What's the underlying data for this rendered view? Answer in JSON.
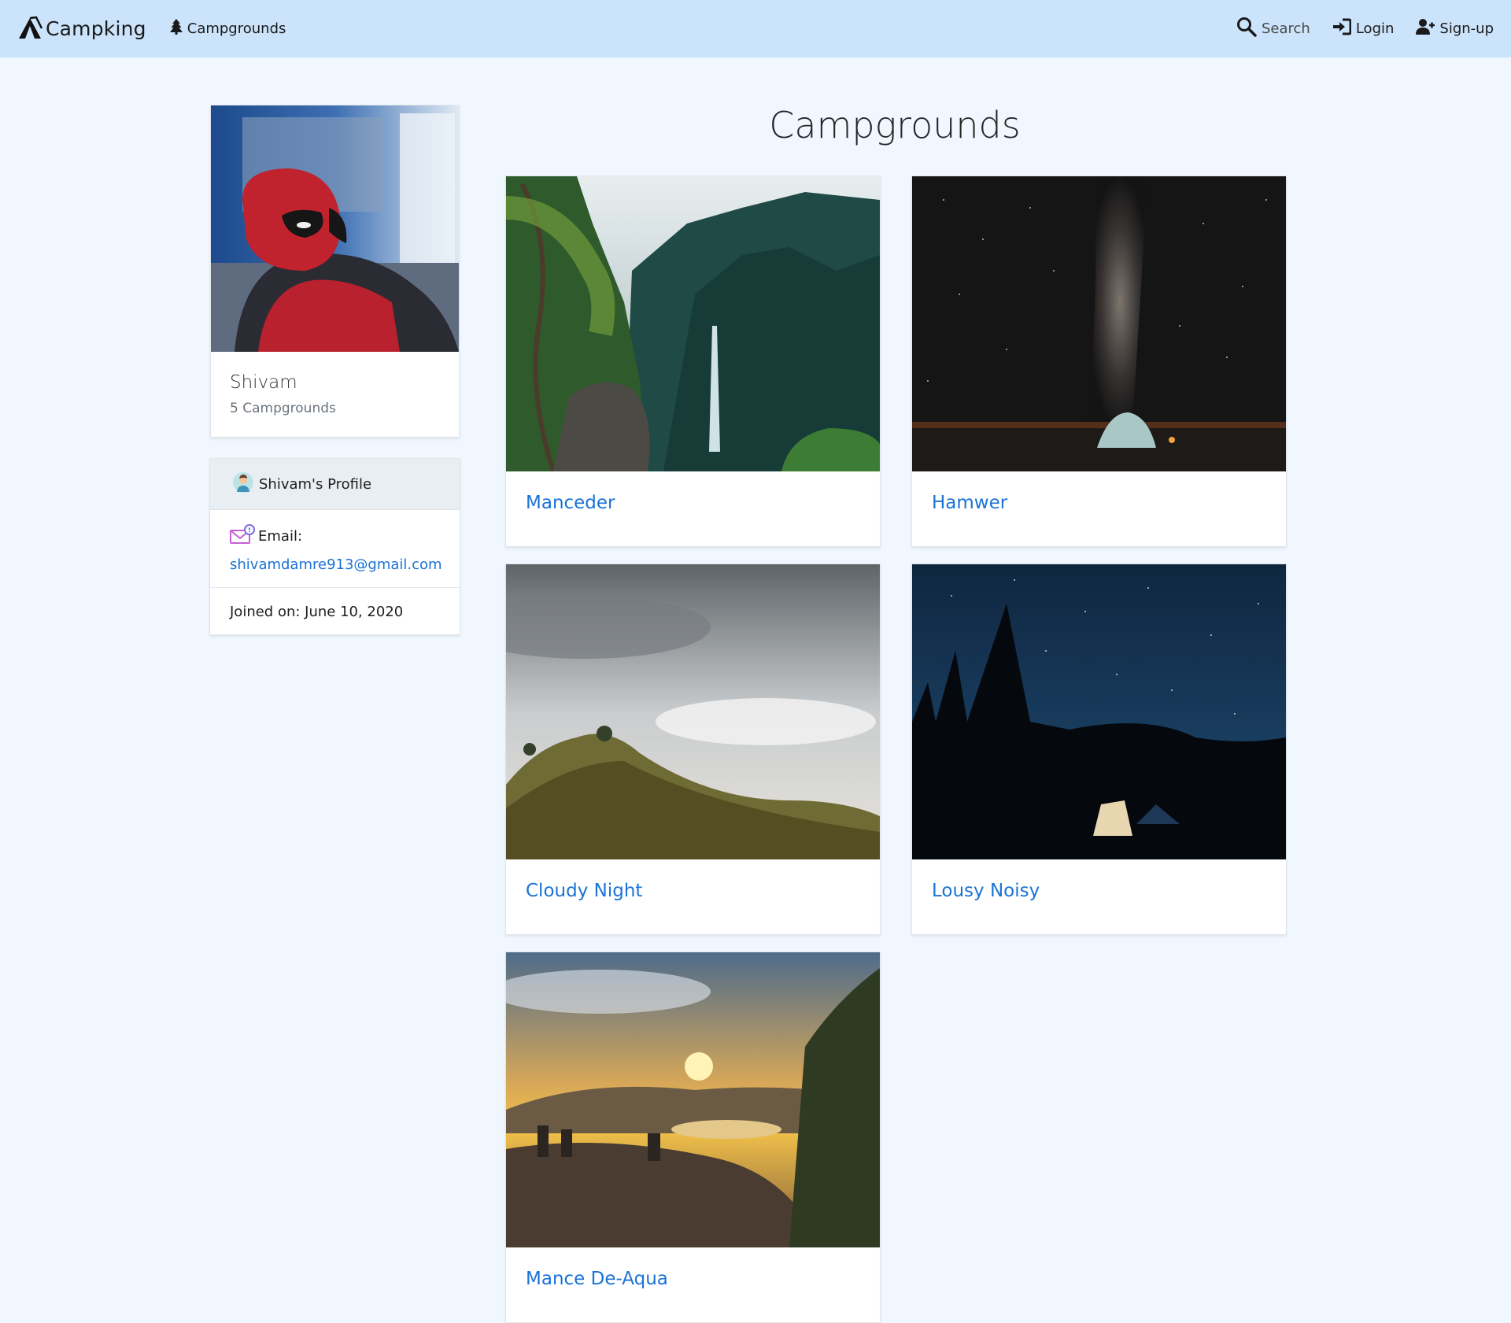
{
  "navbar": {
    "brand": "Campking",
    "campgrounds_link": "Campgrounds",
    "search": "Search",
    "login": "Login",
    "signup": "Sign-up",
    "icons": {
      "brand": "tent-logo-icon",
      "campgrounds": "tree-icon",
      "search": "search-icon",
      "login": "login-icon",
      "signup": "user-plus-icon"
    },
    "background": "#cce4fb"
  },
  "user": {
    "name": "Shivam",
    "campground_count": "5 Campgrounds",
    "profile_title": "Shivam's Profile",
    "email_label": "Email:",
    "email": "shivamdamre913@gmail.com",
    "joined": "Joined on: June 10, 2020"
  },
  "page": {
    "title": "Campgrounds"
  },
  "campgrounds": [
    {
      "name": "Manceder",
      "photo": "forest-waterfall"
    },
    {
      "name": "Hamwer",
      "photo": "milky-way-tent"
    },
    {
      "name": "Cloudy Night",
      "photo": "cloudy-hill"
    },
    {
      "name": "Lousy Noisy",
      "photo": "starry-night-tent"
    },
    {
      "name": "Mance De-Aqua",
      "photo": "sunset-lake"
    }
  ],
  "colors": {
    "page_background": "#f0f7ff",
    "link": "#1a73d6"
  }
}
